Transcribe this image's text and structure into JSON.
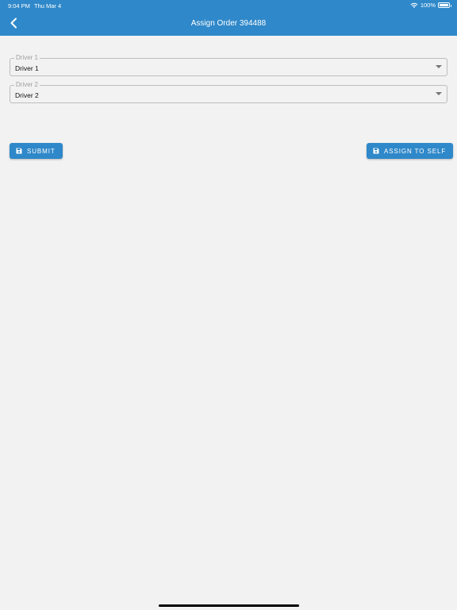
{
  "status_bar": {
    "time": "9:04 PM",
    "date": "Thu Mar 4",
    "battery": "100%",
    "wifi_icon": "wifi-icon",
    "battery_icon": "battery-icon"
  },
  "header": {
    "title": "Assign Order 394488",
    "back_icon": "chevron-left-icon",
    "background_color": "#2f88c9"
  },
  "form": {
    "driver1": {
      "label": "Driver 1",
      "value": "Driver 1"
    },
    "driver2": {
      "label": "Driver 2",
      "value": "Driver 2"
    }
  },
  "actions": {
    "submit_label": "SUBMIT",
    "assign_self_label": "ASSIGN TO SELF",
    "button_icon": "save-icon",
    "accent_color": "#2f88c9"
  }
}
